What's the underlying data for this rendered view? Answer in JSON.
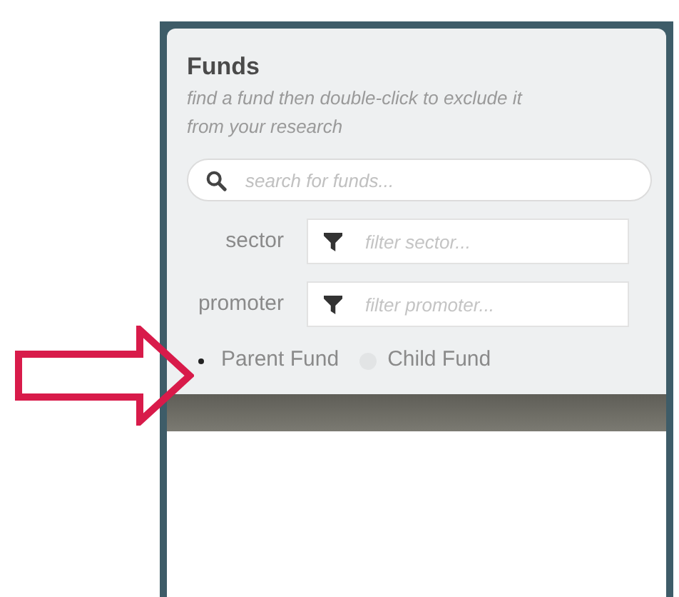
{
  "panel": {
    "title": "Funds",
    "hint": "find a fund then double-click to exclude it from your research"
  },
  "search": {
    "placeholder": "search for funds..."
  },
  "filters": [
    {
      "label": "sector",
      "placeholder": "filter sector..."
    },
    {
      "label": "promoter",
      "placeholder": "filter promoter..."
    }
  ],
  "fund_type": [
    {
      "label": "Parent Fund",
      "selected": true
    },
    {
      "label": "Child Fund",
      "selected": false
    }
  ]
}
